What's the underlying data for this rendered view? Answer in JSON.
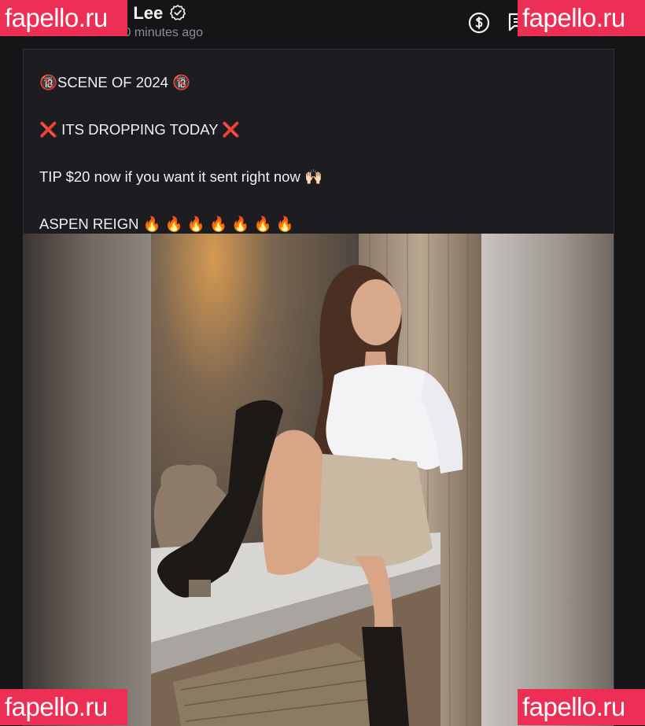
{
  "header": {
    "user_name": "Aspen Lee",
    "seen_text": "Seen · 10 minutes ago"
  },
  "post": {
    "caption": [
      "🔞SCENE OF 2024 🔞",
      "❌ ITS DROPPING TODAY ❌",
      "TIP $20 now if you want it sent right now 🙌🏻",
      "ASPEN REIGN 🔥 🔥 🔥 🔥 🔥 🔥 🔥"
    ]
  },
  "watermark": {
    "text": "fapello.ru"
  },
  "icons": [
    "back-icon",
    "verified-icon",
    "tip-icon",
    "message-icon",
    "search-icon",
    "more-icon"
  ],
  "colors": {
    "background": "#151518",
    "card": "#1c1c21",
    "muted_text": "#8b8d94",
    "watermark": "#ee2f55"
  }
}
